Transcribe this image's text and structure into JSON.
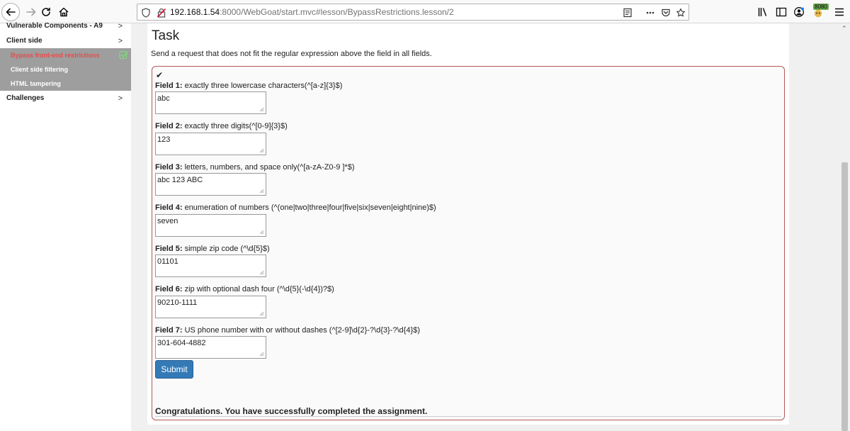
{
  "browser": {
    "url_host": "192.168.1.54",
    "url_path": ":8000/WebGoat/start.mvc#lesson/BypassRestrictions.lesson/2",
    "proxy_badge": "8080"
  },
  "sidebar": {
    "items": [
      {
        "label": "Vulnerable Components - A9",
        "chevron": ">"
      },
      {
        "label": "Client side",
        "chevron": ">"
      },
      {
        "label": "Bypass front-end restrictions"
      },
      {
        "label": "Client side filtering"
      },
      {
        "label": "HTML tampering"
      },
      {
        "label": "Challenges",
        "chevron": ">"
      }
    ]
  },
  "task": {
    "title": "Task",
    "description": "Send a request that does not fit the regular expression above the field in all fields.",
    "checkmark": "✔",
    "fields": [
      {
        "name": "Field 1:",
        "desc": " exactly three lowercase characters(^[a-z]{3}$)",
        "value": "abc"
      },
      {
        "name": "Field 2:",
        "desc": " exactly three digits(^[0-9]{3}$)",
        "value": "123"
      },
      {
        "name": "Field 3:",
        "desc": " letters, numbers, and space only(^[a-zA-Z0-9 ]*$)",
        "value": "abc 123 ABC"
      },
      {
        "name": "Field 4:",
        "desc": " enumeration of numbers (^(one|two|three|four|five|six|seven|eight|nine)$)",
        "value": "seven"
      },
      {
        "name": "Field 5:",
        "desc": " simple zip code (^\\d{5}$)",
        "value": "01101"
      },
      {
        "name": "Field 6:",
        "desc": " zip with optional dash four (^\\d{5}(-\\d{4})?$)",
        "value": "90210-1111"
      },
      {
        "name": "Field 7:",
        "desc": " US phone number with or without dashes (^[2-9]\\d{2}-?\\d{3}-?\\d{4}$)",
        "value": "301-604-4882"
      }
    ],
    "submit_label": "Submit",
    "success_message": "Congratulations. You have successfully completed the assignment."
  }
}
